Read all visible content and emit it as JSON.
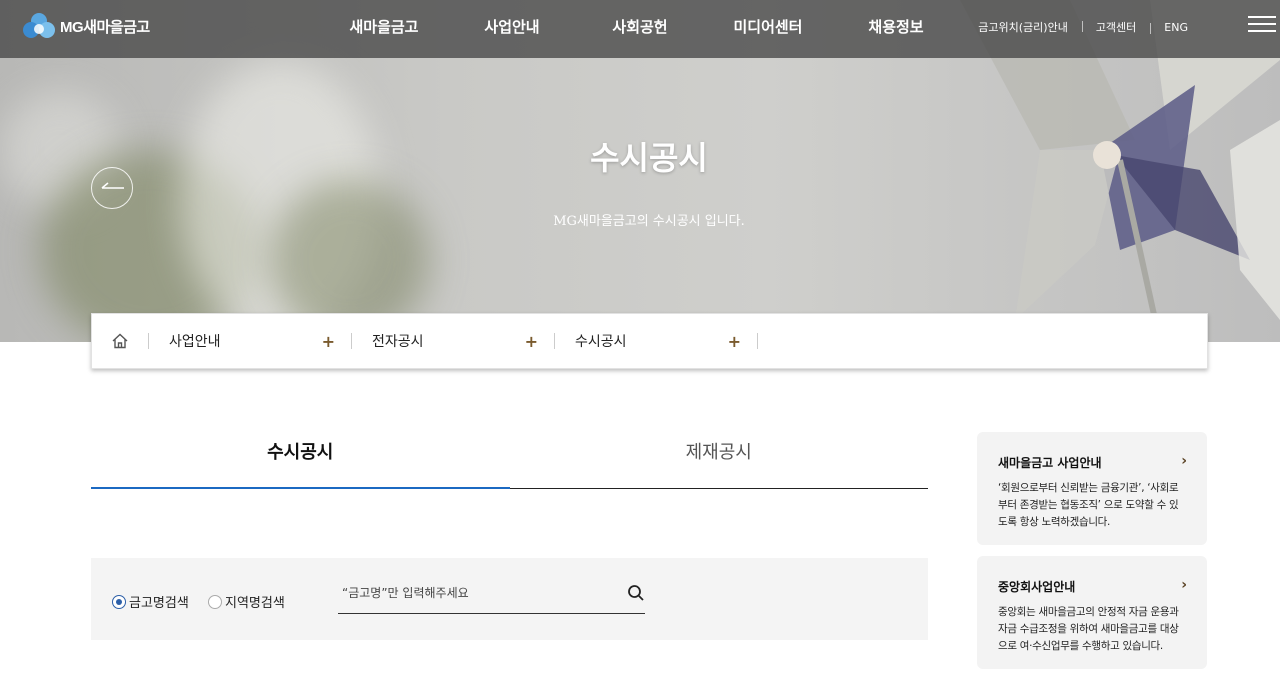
{
  "header": {
    "logo_text": "MG새마을금고",
    "gnb": [
      "새마을금고",
      "사업안내",
      "사회공헌",
      "미디어센터",
      "채용정보"
    ],
    "util": [
      "금고위치(금리)안내",
      "고객센터",
      "ENG"
    ]
  },
  "hero": {
    "title": "수시공시",
    "description": "MG새마을금고의 수시공시 입니다."
  },
  "breadcrumb": {
    "items": [
      "사업안내",
      "전자공시",
      "수시공시"
    ],
    "expand_symbol": "+"
  },
  "tabs": [
    "수시공시",
    "제재공시"
  ],
  "search": {
    "radio_options": [
      "금고명검색",
      "지역명검색"
    ],
    "selected": "금고명검색",
    "placeholder": "“금고명”만 입력해주세요",
    "value": ""
  },
  "side_cards": [
    {
      "title": "새마을금고 사업안내",
      "body": "‘회원으로부터 신뢰받는 금융기관’, ‘사회로부터 존경받는 협동조직’ 으로 도약할 수 있도록 항상 노력하겠습니다."
    },
    {
      "title": "중앙회사업안내",
      "body": "중앙회는 새마을금고의 안정적 자금 운용과 자금 수급조정을 위하여 새마을금고를 대상으로 여·수신업무를 수행하고 있습니다."
    }
  ],
  "colors": {
    "tab_active_underline": "#1b69c2",
    "radio_selected": "#2c5fa8",
    "crumb_plus": "#7a5b2e",
    "logo_blue": "#5aa7e0"
  }
}
